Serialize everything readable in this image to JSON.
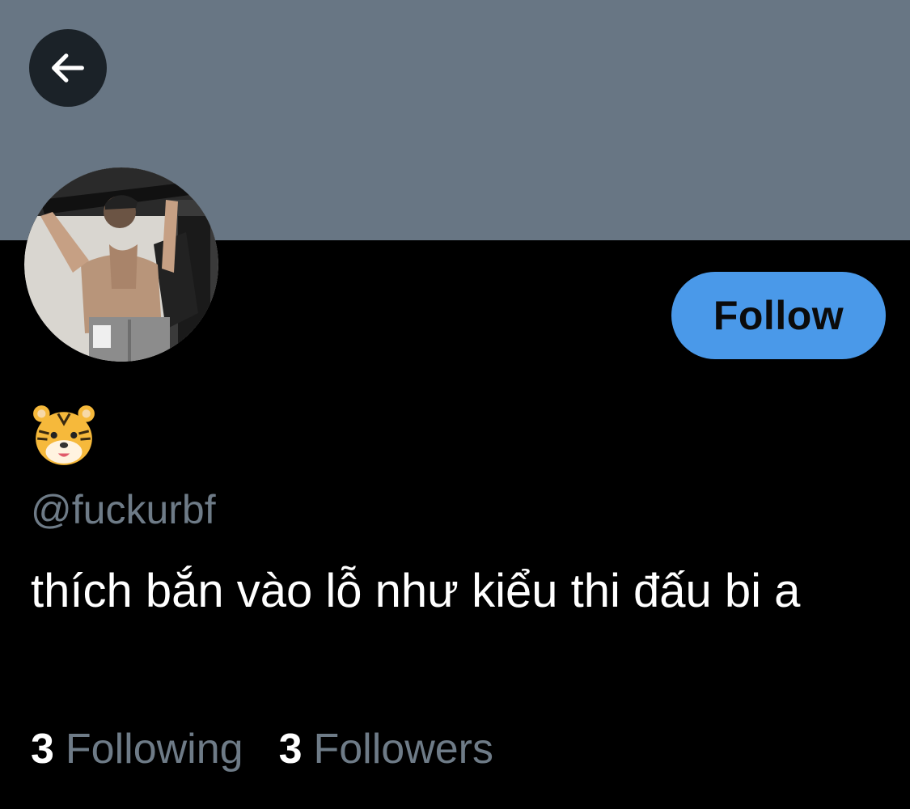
{
  "profile": {
    "display_name_emoji": "tiger-face-emoji",
    "handle": "@fuckurbf",
    "bio": "thích bắn vào lỗ như kiểu thi đấu bi a",
    "follow_label": "Follow",
    "stats": {
      "following_count": "3",
      "following_label": "Following",
      "followers_count": "3",
      "followers_label": "Followers"
    }
  },
  "colors": {
    "banner": "#687684",
    "background": "#000000",
    "accent": "#4a99e9",
    "muted_text": "#6e7b87",
    "back_button_bg": "#1b2228"
  },
  "icons": {
    "back": "arrow-left-icon"
  }
}
